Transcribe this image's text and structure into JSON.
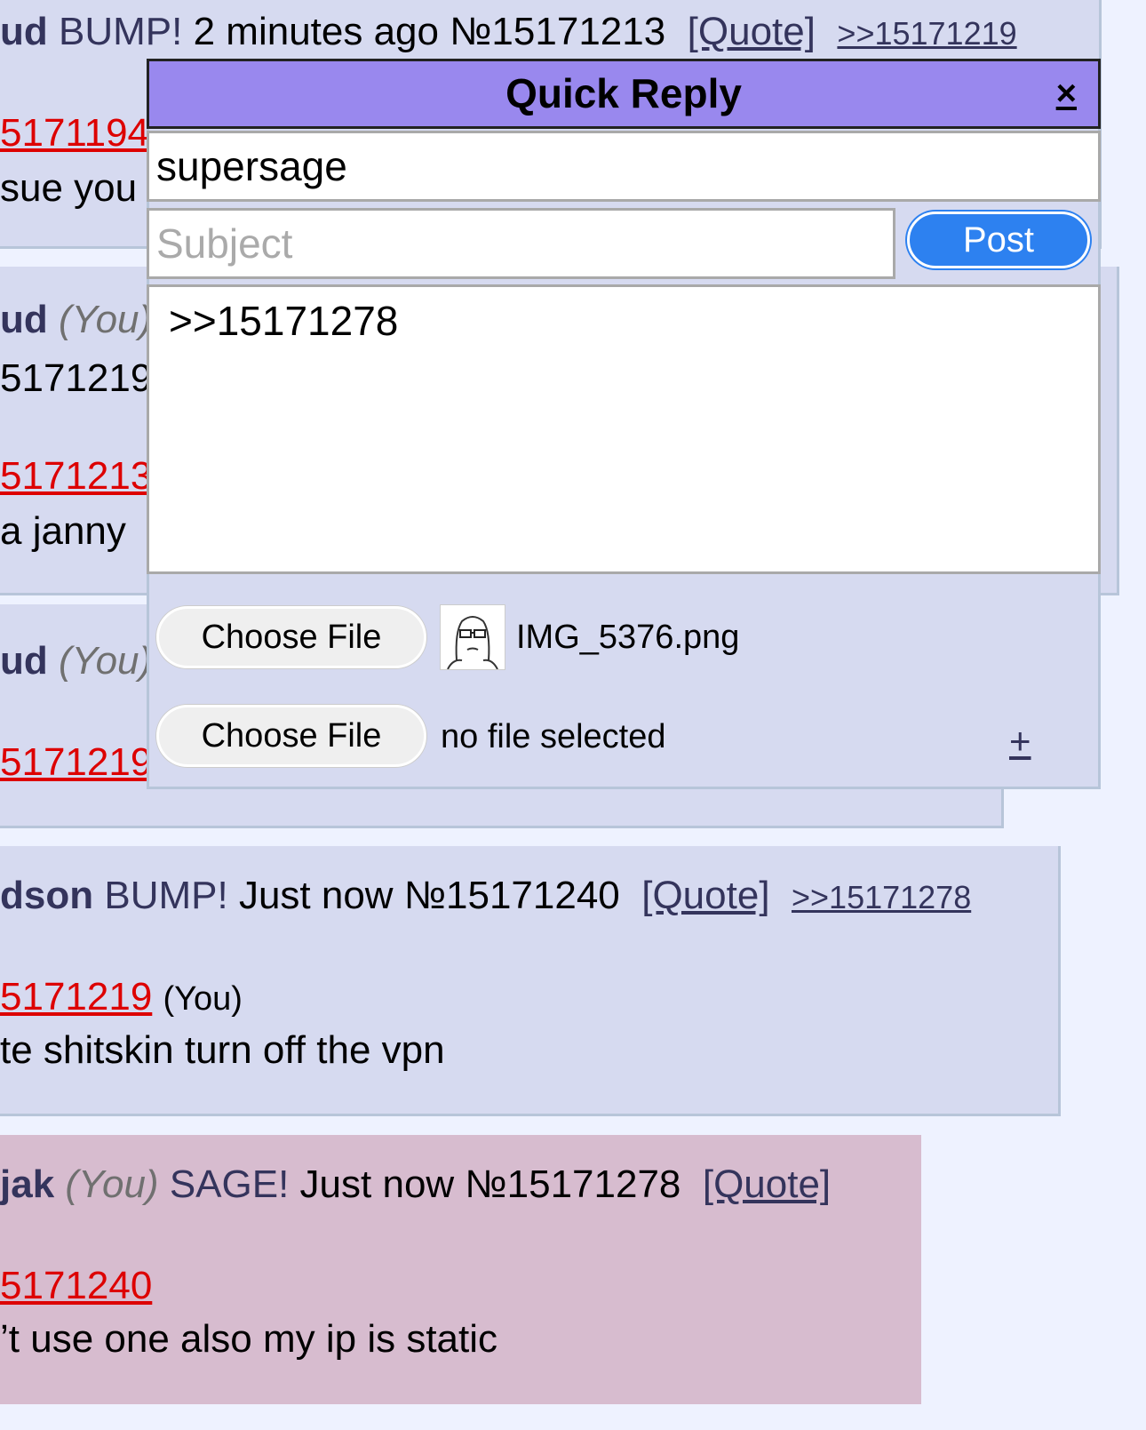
{
  "posts": {
    "p1": {
      "name": "ud",
      "email": "BUMP!",
      "time": "2 minutes ago",
      "number": "№15171213",
      "quote_label": "[Quote]",
      "backlink": ">>15171219",
      "reply_link": "5171194",
      "text": "sue you"
    },
    "p2": {
      "name": "ud",
      "you": "(You)",
      "line2": "5171219",
      "reply_link": "5171213",
      "text": "a janny"
    },
    "p3": {
      "name": "ud",
      "you": "(You)",
      "reply_link": "5171219"
    },
    "p4": {
      "name": "dson",
      "email": "BUMP!",
      "time": "Just now",
      "number": "№15171240",
      "quote_label": "[Quote]",
      "backlink": ">>15171278",
      "reply_link": "5171219",
      "reply_you": "(You)",
      "text": "te shitskin turn off the vpn"
    },
    "p5": {
      "name": "jak",
      "you": "(You)",
      "email": "SAGE!",
      "time": "Just now",
      "number": "№15171278",
      "quote_label": "[Quote]",
      "reply_link": "5171240",
      "text": "’t use one also my ip is static"
    }
  },
  "quick_reply": {
    "title": "Quick Reply",
    "close_label": "×",
    "name_value": "supersage",
    "subject_placeholder": "Subject",
    "post_label": "Post",
    "comment_value": ">>15171278",
    "file1_button": "Choose File",
    "file1_name": "IMG_5376.png",
    "file2_button": "Choose File",
    "file2_name": "no file selected",
    "add_file_label": "+"
  },
  "colors": {
    "page_bg": "#eef2ff",
    "post_bg": "#d6daf0",
    "own_post_bg": "#d7bccf",
    "qr_header": "#9988ee",
    "post_button": "#2d81f0",
    "quotelink": "#dd0000"
  }
}
